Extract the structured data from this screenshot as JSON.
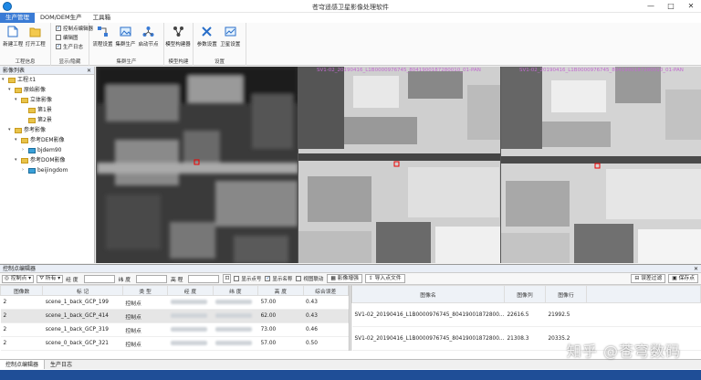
{
  "window": {
    "title": "苍穹遥感卫星影像处理软件",
    "controls": [
      "—",
      "□",
      "✕"
    ]
  },
  "tabs": [
    "生产管理",
    "DOM/DEM生产",
    "工具箱"
  ],
  "ribbon": {
    "groups": [
      {
        "label": "工程信息",
        "buttons": [
          "新建工程",
          "打开工程"
        ],
        "checks": [
          {
            "label": "控制点编辑器",
            "checked": true
          },
          {
            "label": "编辑图",
            "checked": false
          },
          {
            "label": "生产日志",
            "checked": true
          }
        ],
        "checks_group_label": "显示/隐藏"
      },
      {
        "label": "集群生产",
        "buttons": [
          "流程设置",
          "集群生产",
          "启动节点"
        ]
      },
      {
        "label": "模型构建",
        "buttons": [
          "模型构建器"
        ]
      },
      {
        "label": "设置",
        "buttons": [
          "参数设置",
          "卫星设置"
        ]
      }
    ]
  },
  "left_panel": {
    "title": "影像列表",
    "tree": [
      {
        "label": "工程:t1",
        "level": 0,
        "kind": "folder"
      },
      {
        "label": "原始影像",
        "level": 1,
        "kind": "folder"
      },
      {
        "label": "立体影像",
        "level": 2,
        "kind": "folder"
      },
      {
        "label": "第1景",
        "level": 3,
        "kind": "folder"
      },
      {
        "label": "第2景",
        "level": 3,
        "kind": "folder"
      },
      {
        "label": "参考影像",
        "level": 1,
        "kind": "folder"
      },
      {
        "label": "参考DEM影像",
        "level": 2,
        "kind": "folder"
      },
      {
        "label": "bjdem90",
        "level": 3,
        "kind": "layer"
      },
      {
        "label": "参考DOM影像",
        "level": 2,
        "kind": "folder"
      },
      {
        "label": "beijingdom",
        "level": 3,
        "kind": "layer"
      }
    ]
  },
  "image_views": [
    {
      "label": ""
    },
    {
      "label": "SV1-02_20190416_L1B0000976745_8041900187280010_01-PAN"
    },
    {
      "label": "SV1-02_20190416_L1B0000976745_8041900187280010_01-PAN"
    }
  ],
  "editor": {
    "title": "控制点编辑器",
    "toolbar": {
      "mode": "控制点",
      "filter": "所有",
      "lon_label": "经 度",
      "lat_label": "纬 度",
      "height_label": "高 程",
      "check_show_id": "显示点号",
      "check_show_name": "显示名称",
      "check_link": "视图联动",
      "btn_enhance": "影像增强",
      "btn_import": "导入点文件",
      "btn_filter_err": "误差过滤",
      "btn_save": "保存点"
    },
    "columns": [
      "图像数",
      "标 记",
      "类 型",
      "经 度",
      "纬 度",
      "高 度",
      "综合误差"
    ],
    "rows": [
      {
        "count": "2",
        "mark": "scene_1_back_GCP_199",
        "type": "控制点",
        "height": "57.00",
        "err": "0.43"
      },
      {
        "count": "2",
        "mark": "scene_1_back_GCP_414",
        "type": "控制点",
        "height": "62.00",
        "err": "0.43"
      },
      {
        "count": "2",
        "mark": "scene_1_back_GCP_319",
        "type": "控制点",
        "height": "73.00",
        "err": "0.46"
      },
      {
        "count": "2",
        "mark": "scene_0_back_GCP_321",
        "type": "控制点",
        "height": "57.00",
        "err": "0.50"
      }
    ],
    "right_columns": [
      "图像名",
      "图像列",
      "图像行"
    ],
    "right_rows": [
      {
        "name": "SV1-02_20190416_L1B0000976745_80419001872800...",
        "col": "22616.5",
        "row": "21992.5"
      },
      {
        "name": "SV1-02_20190416_L1B0000976745_80419001872800...",
        "col": "21308.3",
        "row": "20335.2"
      }
    ]
  },
  "bottom_tabs": [
    "控制点编辑器",
    "生产日志"
  ],
  "watermark": "知乎 @苍穹数码"
}
